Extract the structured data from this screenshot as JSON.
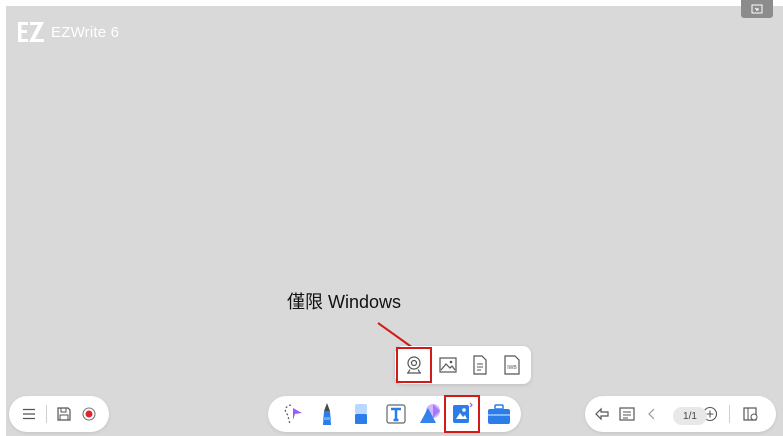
{
  "app": {
    "title": "EZWrite 6"
  },
  "annotation": {
    "text": "僅限 Windows"
  },
  "insert_menu": {
    "items": [
      {
        "name": "camera",
        "icon": "webcam-icon"
      },
      {
        "name": "image",
        "icon": "image-icon"
      },
      {
        "name": "document",
        "icon": "document-icon"
      },
      {
        "name": "iwb",
        "icon": "iwb-file-icon",
        "label": "IWB"
      }
    ]
  },
  "left_toolbar": {
    "icons": [
      "menu-icon",
      "save-icon",
      "record-icon"
    ]
  },
  "center_toolbar": {
    "icons": [
      "lasso-select-icon",
      "pen-icon",
      "eraser-icon",
      "text-icon",
      "shapes-icon",
      "insert-icon",
      "toolbox-icon"
    ]
  },
  "right_toolbar": {
    "icons": [
      "undo-icon",
      "page-list-icon",
      "prev-page-icon",
      "add-page-icon",
      "page-manager-icon"
    ],
    "page_indicator": "1/1"
  },
  "colors": {
    "canvas": "#d9d9d9",
    "highlight": "#d11a1a",
    "accent_blue": "#2b7de9",
    "accent_purple": "#9a5cff",
    "record_red": "#e0242c"
  }
}
